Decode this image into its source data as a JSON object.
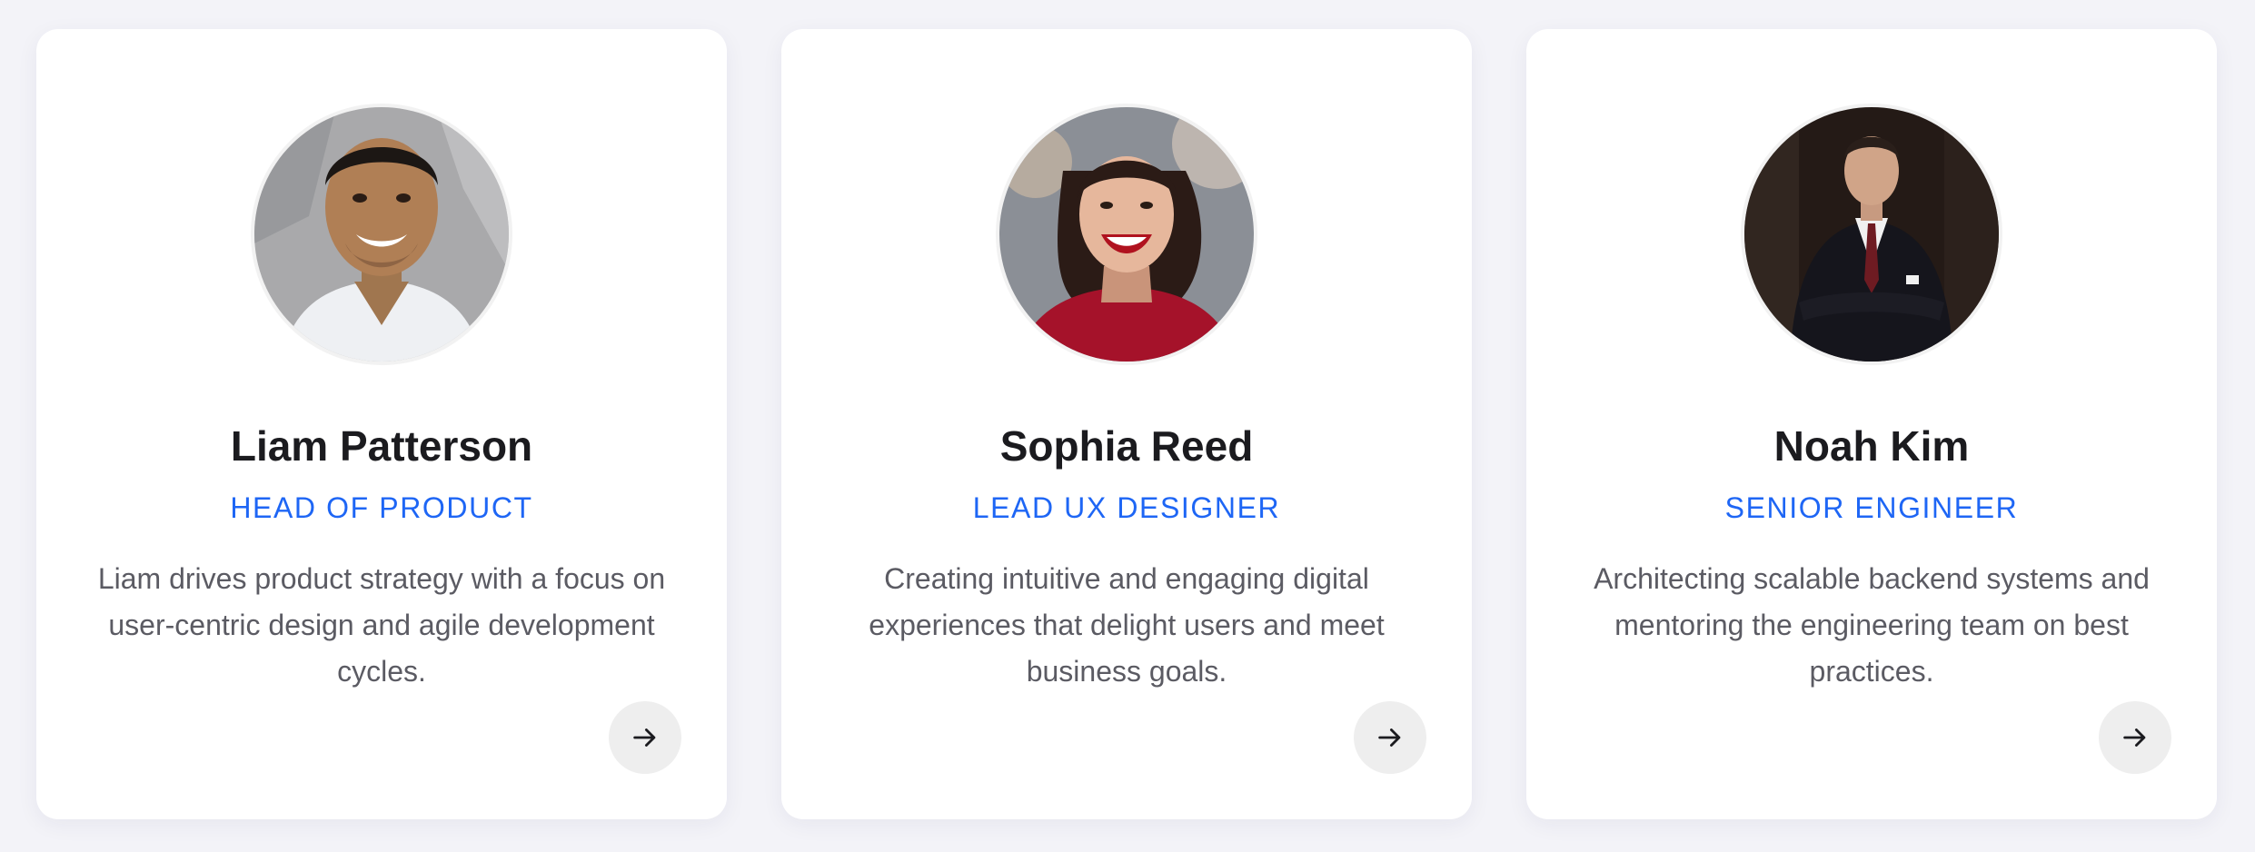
{
  "colors": {
    "page_background": "#f3f3f8",
    "card_background": "#ffffff",
    "name": "#1b1b1f",
    "role_accent": "#1e66f5",
    "bio_text": "#5b5b63",
    "arrow_button_bg": "#eeeeee"
  },
  "team": [
    {
      "name": "Liam Patterson",
      "role": "HEAD OF PRODUCT",
      "bio": "Liam drives product strategy with a focus on user-centric design and agile development cycles.",
      "avatar_icon": "person-photo-white-tshirt",
      "action_icon": "arrow-right-icon"
    },
    {
      "name": "Sophia Reed",
      "role": "LEAD UX DESIGNER",
      "bio": "Creating intuitive and engaging digital experiences that delight users and meet business goals.",
      "avatar_icon": "person-photo-red-sweater",
      "action_icon": "arrow-right-icon"
    },
    {
      "name": "Noah Kim",
      "role": "SENIOR ENGINEER",
      "bio": "Architecting scalable backend systems and mentoring the engineering team on best practices.",
      "avatar_icon": "person-photo-dark-suit",
      "action_icon": "arrow-right-icon"
    }
  ]
}
